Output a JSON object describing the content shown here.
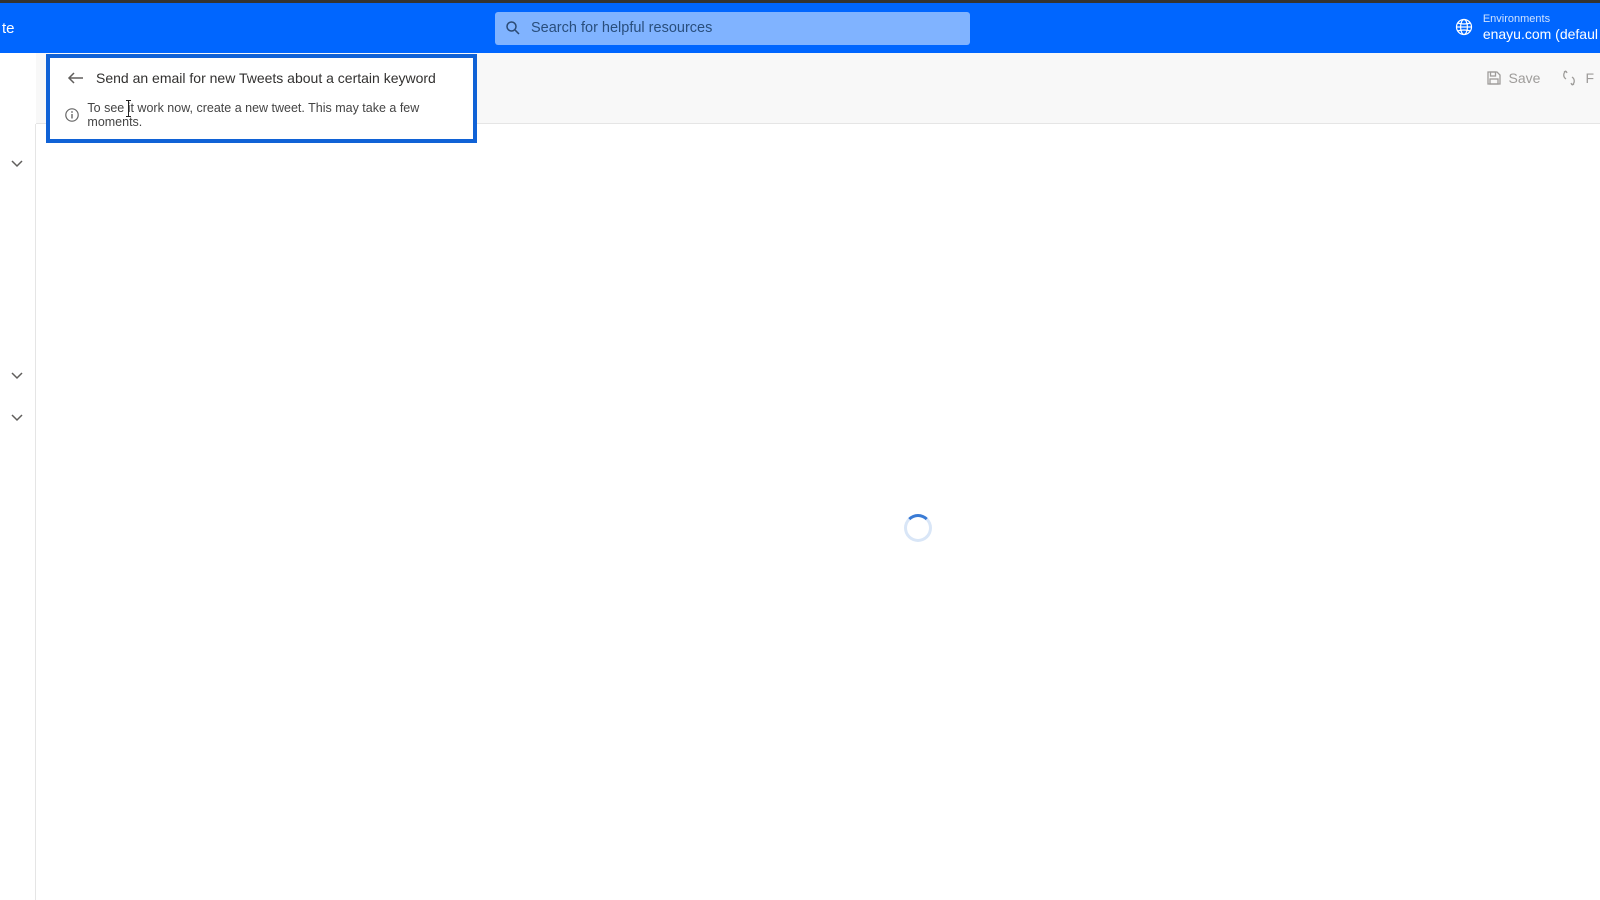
{
  "topbar": {
    "left_fragment": "te",
    "search_placeholder": "Search for helpful resources",
    "env_label": "Environments",
    "env_value": "enayu.com (defaul"
  },
  "flow": {
    "title": "Send an email for new Tweets about a certain keyword",
    "info": "To see it work now, create a new tweet. This may take a few moments."
  },
  "toolbar": {
    "save_label": "Save",
    "flow_fragment": "F"
  }
}
